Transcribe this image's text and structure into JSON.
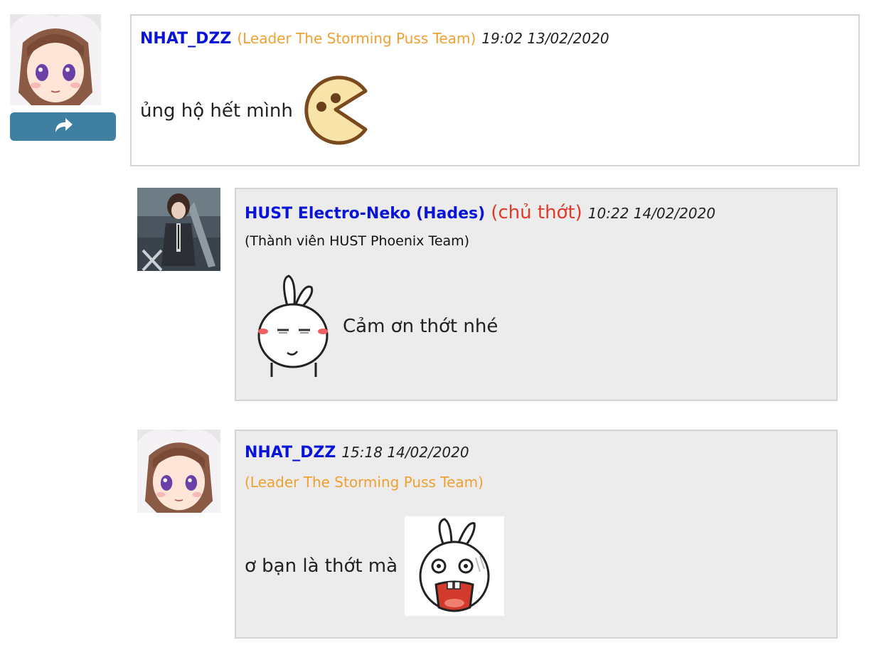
{
  "comments": [
    {
      "username": "NHAT_DZZ",
      "team": "(Leader The Storming Puss Team)",
      "time": "19:02 13/02/2020",
      "message": "ủng hộ hết mình"
    },
    {
      "username": "HUST Electro-Neko (Hades)",
      "owner_tag": "(chủ thớt)",
      "time": "10:22 14/02/2020",
      "member": "(Thành viên HUST Phoenix Team)",
      "message": "Cảm ơn thớt nhé"
    },
    {
      "username": "NHAT_DZZ",
      "team": "(Leader The Storming Puss Team)",
      "time": "15:18 14/02/2020",
      "message": "ơ bạn là thớt mà"
    }
  ],
  "icons": {
    "reply": "reply-arrow-icon",
    "emoticon_1": "pacman-emoticon",
    "emoticon_2": "rabbit-smug-emoticon",
    "emoticon_3": "rabbit-shocked-emoticon"
  },
  "colors": {
    "username": "#0a14d8",
    "team": "#f0a030",
    "owner_tag": "#e03a2a",
    "reply_button": "#3f7fa1",
    "reply_box": "#ececec"
  }
}
